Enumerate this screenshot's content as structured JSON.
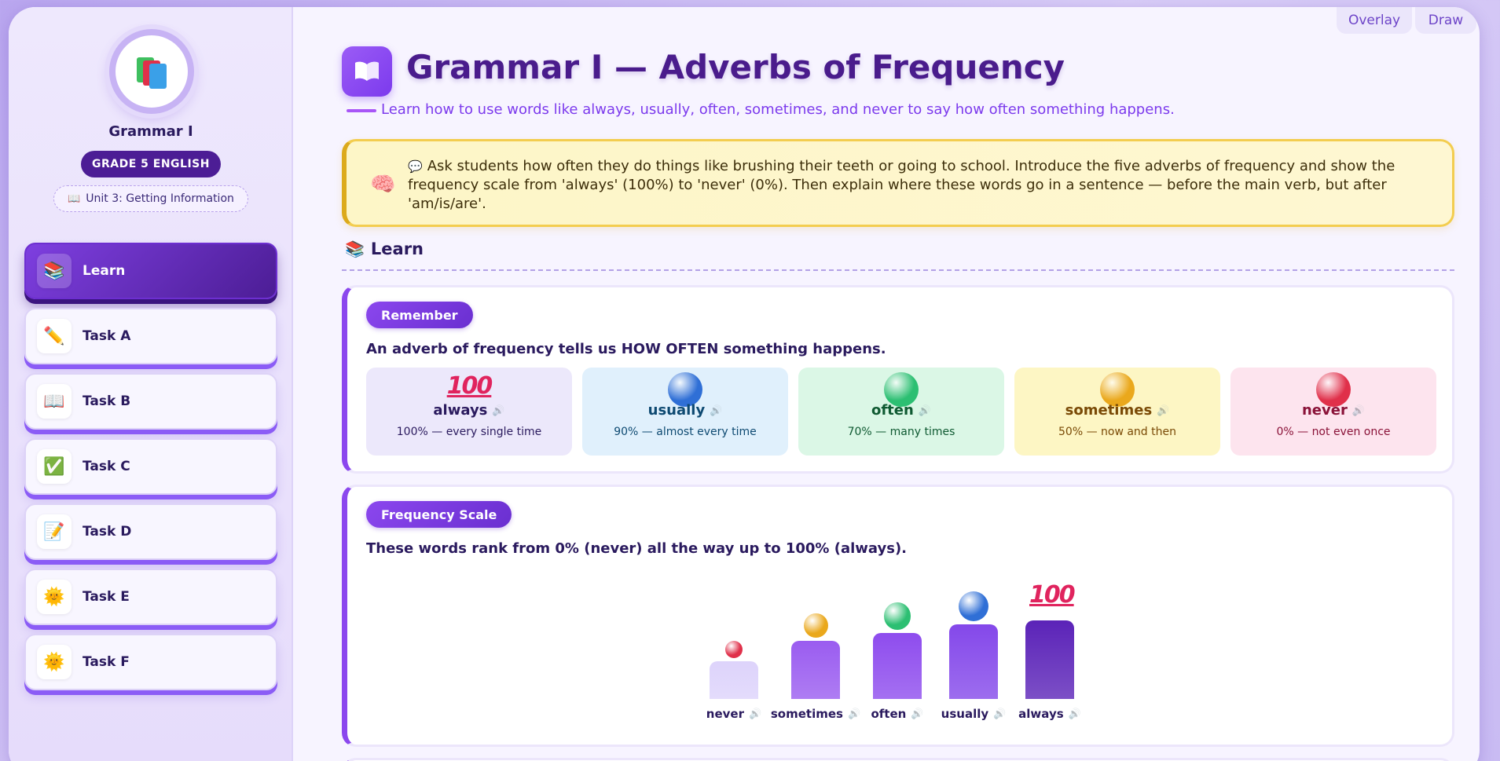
{
  "top_buttons": {
    "overlay": "Overlay",
    "draw": "Draw"
  },
  "sidebar": {
    "title": "Grammar I",
    "grade": "GRADE 5 ENGLISH",
    "unit_icon": "📖",
    "unit": "Unit 3: Getting Information",
    "items": [
      {
        "label": "Learn",
        "icon": "books-icon",
        "glyph": "📚",
        "active": true
      },
      {
        "label": "Task A",
        "icon": "pencil-icon",
        "glyph": "✏️",
        "active": false
      },
      {
        "label": "Task B",
        "icon": "open-book-icon",
        "glyph": "📖",
        "active": false
      },
      {
        "label": "Task C",
        "icon": "checkmark-icon",
        "glyph": "✅",
        "active": false
      },
      {
        "label": "Task D",
        "icon": "memo-icon",
        "glyph": "📝",
        "active": false
      },
      {
        "label": "Task E",
        "icon": "sun-icon",
        "glyph": "🌞",
        "active": false
      },
      {
        "label": "Task F",
        "icon": "sun-icon",
        "glyph": "🌞",
        "active": false
      }
    ]
  },
  "header": {
    "title": "Grammar I — Adverbs of Frequency",
    "subtitle": "Learn how to use words like always, usually, often, sometimes, and never to say how often something happens."
  },
  "teacher_note": {
    "icon": "💬",
    "text": "Ask students how often they do things like brushing their teeth or going to school. Introduce the five adverbs of frequency and show the frequency scale from 'always' (100%) to 'never' (0%). Then explain where these words go in a sentence — before the main verb, but after 'am/is/are'."
  },
  "section": {
    "icon": "📚",
    "title": "Learn"
  },
  "remember": {
    "badge": "Remember",
    "lead": "An adverb of frequency tells us HOW OFTEN something happens.",
    "tiles": [
      {
        "word": "always",
        "desc": "100% — every single time",
        "bg": "#ece8fb",
        "fg": "#2a1a5e",
        "mark": "100"
      },
      {
        "word": "usually",
        "desc": "90% — almost every time",
        "bg": "#e0f0fc",
        "fg": "#0e4a72",
        "ball": "#2f6fd6"
      },
      {
        "word": "often",
        "desc": "70% — many times",
        "bg": "#dbf7e6",
        "fg": "#0f5a32",
        "ball": "#2cbf72"
      },
      {
        "word": "sometimes",
        "desc": "50% — now and then",
        "bg": "#fdf6c4",
        "fg": "#7a4a06",
        "ball": "#eaa81c"
      },
      {
        "word": "never",
        "desc": "0% — not even once",
        "bg": "#fde4ee",
        "fg": "#8a1238",
        "ball": "#e0304a"
      }
    ]
  },
  "scale": {
    "badge": "Frequency Scale",
    "lead": "These words rank from 0% (never) all the way up to 100% (always).",
    "chart_data": {
      "type": "bar",
      "categories": [
        "never",
        "sometimes",
        "often",
        "usually",
        "always"
      ],
      "values": [
        0,
        50,
        70,
        90,
        100
      ],
      "colors": [
        "#ddd3fb",
        "#9a5cf0",
        "#8e4cee",
        "#8448ea",
        "#5b23b8"
      ]
    }
  }
}
